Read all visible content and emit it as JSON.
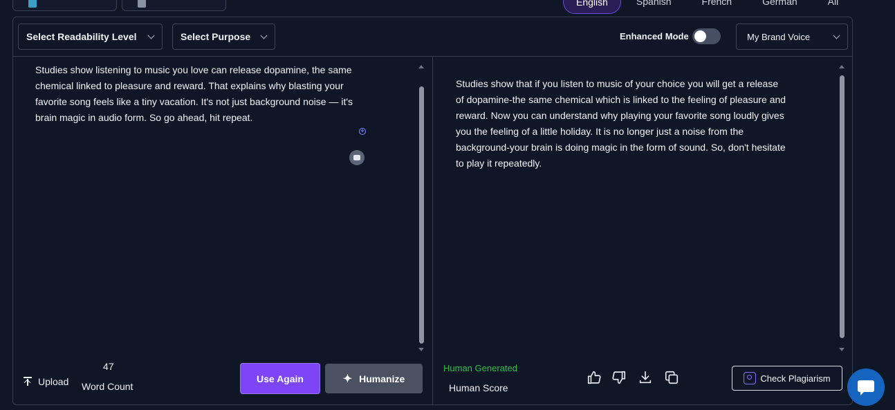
{
  "languages": [
    "English",
    "Spanish",
    "French",
    "German",
    "All"
  ],
  "active_language": "English",
  "toolbar": {
    "readability": "Select Readability Level",
    "purpose": "Select Purpose",
    "enhanced_mode": "Enhanced Mode",
    "enhanced_mode_on": false,
    "brand_voice": "My Brand Voice"
  },
  "input": {
    "text": " Studies show listening to music you love can release dopamine, the same chemical linked to pleasure and reward. That explains why blasting your favorite song feels like a tiny vacation. It's not just background noise — it's brain magic in audio form. So go ahead, hit repeat.",
    "upload_label": "Upload",
    "word_count": "47",
    "word_count_label": "Word Count",
    "use_again": "Use Again",
    "humanize": "Humanize"
  },
  "output": {
    "text": "Studies show that if you listen to music of your choice you will get a release of dopamine-the same chemical which is linked to the feeling of pleasure and reward. Now you can understand why playing your favorite song loudly gives you the feeling of a little holiday. It is no longer just a noise from the background-your brain is doing magic in the form of sound. So, don't hesitate to play it repeatedly.",
    "human_generated": "Human Generated",
    "human_score_label": "Human Score",
    "check_plagiarism": "Check Plagiarism"
  },
  "colors": {
    "accent": "#7c45f5",
    "background": "#0f1626",
    "human_green": "#2fbf4a",
    "chat": "#1565c0"
  },
  "icons": [
    "chevron-down-icon",
    "upload-icon",
    "sparkle-icon",
    "thumbs-up-icon",
    "thumbs-down-icon",
    "download-icon",
    "copy-icon",
    "plagiarism-scan-icon",
    "chat-icon",
    "add-circle-icon",
    "bot-icon"
  ]
}
